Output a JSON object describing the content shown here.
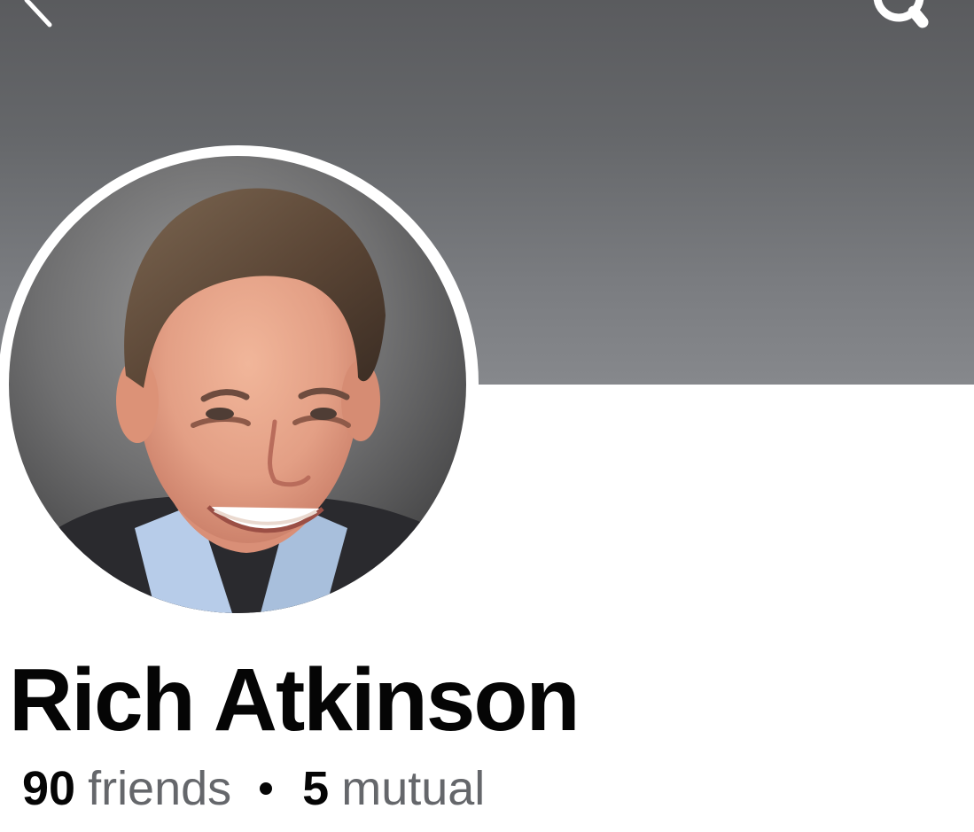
{
  "header": {
    "back_icon": "chevron-left-icon",
    "search_icon": "search-icon"
  },
  "profile": {
    "name": "Rich Atkinson",
    "avatar": "profile-photo",
    "friends_count": "90",
    "friends_label": "friends",
    "separator": "•",
    "mutual_count": "5",
    "mutual_label": "mutual"
  },
  "colors": {
    "cover": "#65676a",
    "name_text": "#050505",
    "secondary_text": "#65676b",
    "background": "#ffffff"
  }
}
